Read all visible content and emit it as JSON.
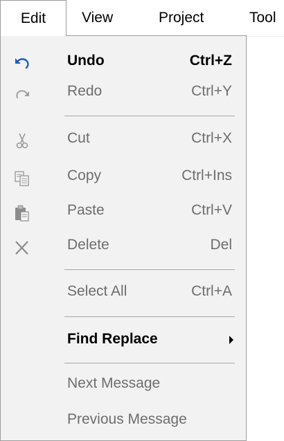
{
  "menubar": {
    "items": [
      {
        "label": "Edit"
      },
      {
        "label": "View"
      },
      {
        "label": "Project"
      },
      {
        "label": "Tool"
      }
    ]
  },
  "edit_menu": {
    "items": [
      {
        "label": "Undo",
        "shortcut": "Ctrl+Z",
        "icon": "undo-icon"
      },
      {
        "label": "Redo",
        "shortcut": "Ctrl+Y",
        "icon": "redo-icon"
      },
      {
        "label": "Cut",
        "shortcut": "Ctrl+X",
        "icon": "cut-icon"
      },
      {
        "label": "Copy",
        "shortcut": "Ctrl+Ins",
        "icon": "copy-icon"
      },
      {
        "label": "Paste",
        "shortcut": "Ctrl+V",
        "icon": "paste-icon"
      },
      {
        "label": "Delete",
        "shortcut": "Del",
        "icon": "delete-icon"
      },
      {
        "label": "Select All",
        "shortcut": "Ctrl+A"
      },
      {
        "label": "Find Replace"
      },
      {
        "label": "Next Message"
      },
      {
        "label": "Previous Message"
      }
    ]
  },
  "colors": {
    "menu_bg": "#f2f2f2",
    "disabled_text": "#6d6d6d",
    "separator": "#a8a8a8",
    "undo_icon": "#1f5fbf"
  }
}
